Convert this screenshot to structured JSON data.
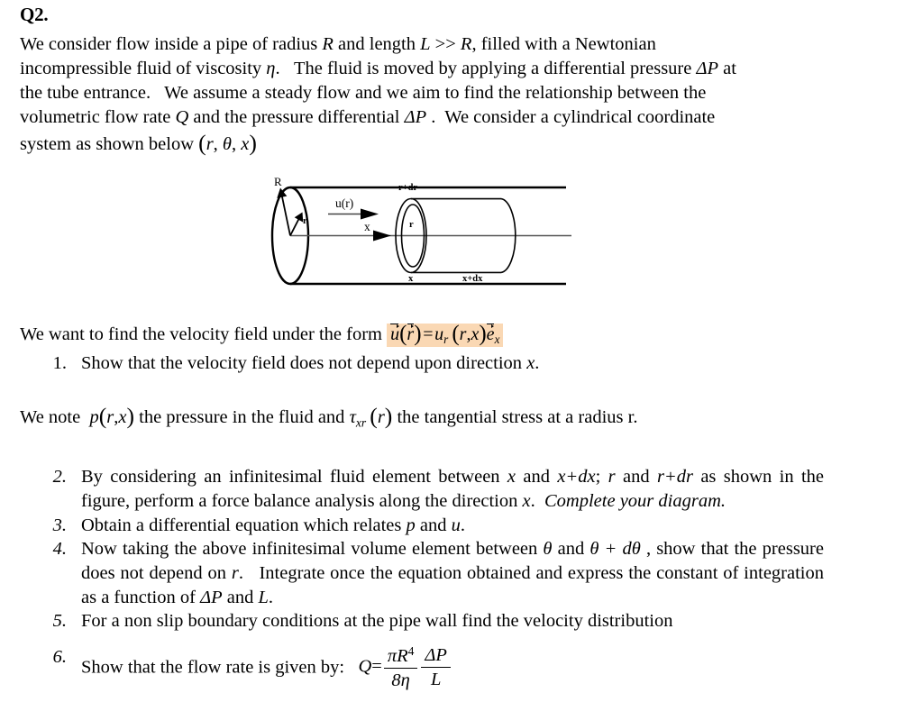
{
  "question": {
    "label": "Q2.",
    "intro_lines": [
      "We consider flow inside a pipe of radius R and length L >> R, filled with a Newtonian",
      "incompressible fluid of viscosity η.  The fluid is moved by applying a differential pressure ΔP at",
      "the tube entrance.  We assume a steady flow and we aim to find the relationship between the",
      "volumetric flow rate Q and the pressure differential ΔP .  We consider a cylindrical coordinate",
      "system as shown below (r, θ, x)"
    ]
  },
  "diagram": {
    "caption_labels": {
      "radius_outer": "R",
      "radius_inner": "r",
      "velocity_profile": "u(r)",
      "axis": "x",
      "element_outer_radius": "r+dr",
      "element_inner_radius": "r",
      "element_left_face": "x",
      "element_right_face": "x+dx"
    }
  },
  "velocity_field": {
    "lead_text": "We want to find the velocity field under the form",
    "equation": {
      "u_vec": "u",
      "r_vec": "r",
      "equals": "=",
      "u_sub": "r",
      "args": "(r,x)",
      "e_vec": "e",
      "e_sub": "x",
      "plain": "ṻ(r⃗) = u_r (r,x) e⃗_x"
    },
    "highlight_color": "#fad8b4"
  },
  "note": {
    "lead": "We note",
    "pressure_symbol": "p(r,x)",
    "middle": "the pressure in the fluid and",
    "stress_symbol": "τ_xr (r)",
    "tail": "the tangential stress at a radius r.",
    "plain": "We note p(r,x) the pressure in the fluid and τxr(r) the tangential stress at a radius r."
  },
  "items": [
    {
      "number": "1.",
      "number_style": "upright",
      "text": "Show that the velocity field does not depend upon direction x."
    },
    {
      "number": "2.",
      "number_style": "italic",
      "line1": "By considering an infinitesimal fluid element between x and x+dx; r and r+dr as shown in",
      "line2_a": "the figure, perform a force balance analysis along the direction x.",
      "line2_emph": "Complete your diagram."
    },
    {
      "number": "3.",
      "number_style": "italic",
      "text": "Obtain a differential equation which relates p and u."
    },
    {
      "number": "4.",
      "number_style": "italic",
      "line1": "Now taking the above infinitesimal volume element between θ and θ + dθ , show that the",
      "line2": "pressure does not depend on r.  Integrate once the equation obtained and express the",
      "line3": "constant of integration as a function of ΔP and L."
    },
    {
      "number": "5.",
      "number_style": "italic",
      "text": "For a non slip boundary conditions at the pipe wall find the velocity distribution"
    },
    {
      "number": "6.",
      "number_style": "italic",
      "text": "Show that the flow rate is given by:",
      "formula": {
        "lhs": "Q",
        "equals": "=",
        "frac1_num": "πR⁴",
        "frac1_num_base": "πR",
        "frac1_num_exp": "4",
        "frac1_den": "8η",
        "frac2_num": "ΔP",
        "frac2_den": "L",
        "plain": "Q = (πR⁴ / 8η)(ΔP / L)"
      }
    }
  ]
}
